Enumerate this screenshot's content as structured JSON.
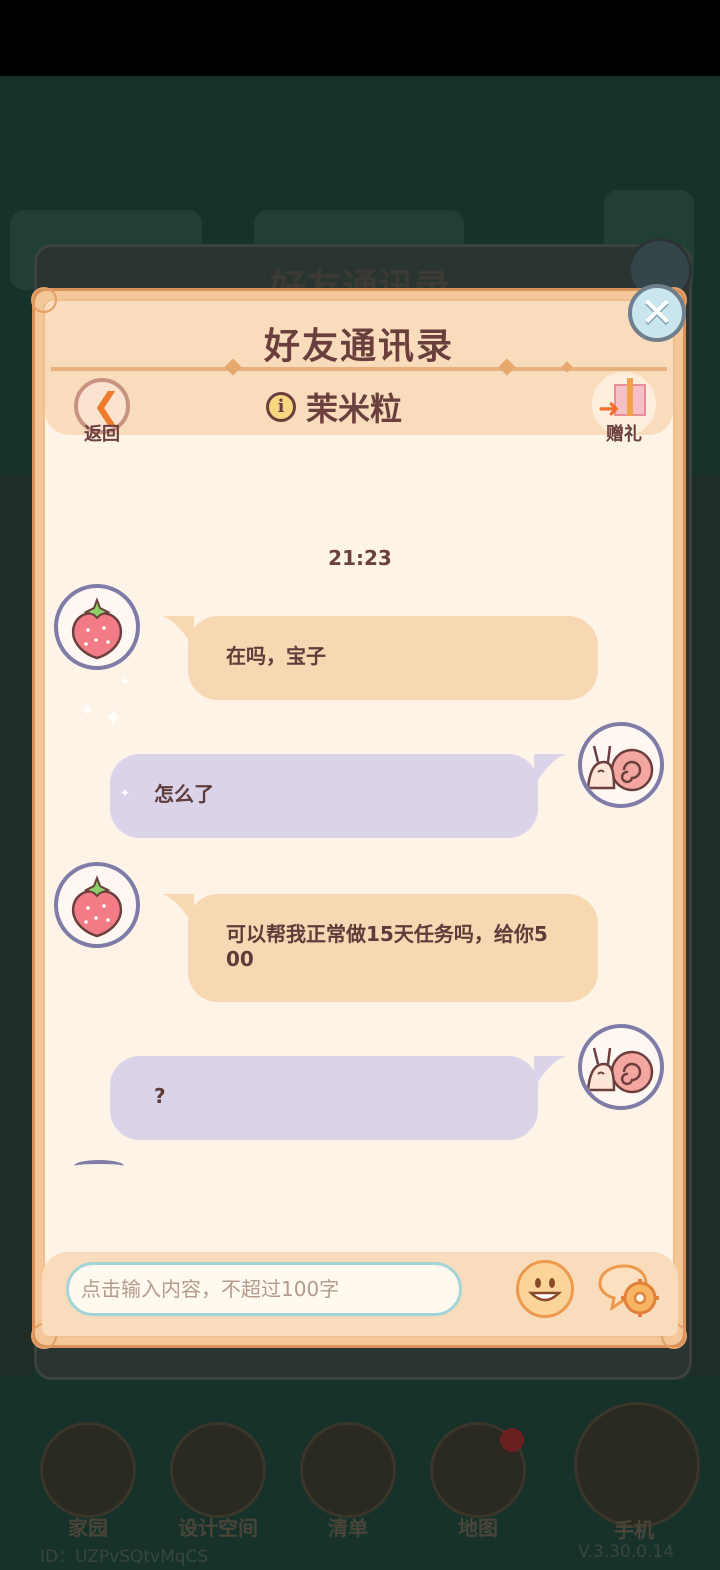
{
  "background": {
    "panel_title": "好友通讯录",
    "nav": [
      {
        "label": "家园"
      },
      {
        "label": "设计空间"
      },
      {
        "label": "清单"
      },
      {
        "label": "地图"
      }
    ],
    "phone_label": "手机",
    "id_text": "ID：UZPvSQtvMqCS",
    "version": "V.3.30.0.14"
  },
  "dialog": {
    "title": "好友通讯录",
    "back_label": "返回",
    "gift_label": "赠礼",
    "contact_name": "茉米粒",
    "info_icon": "i",
    "close_icon": "✕"
  },
  "chat": {
    "timestamp": "21:23",
    "messages": [
      {
        "side": "left",
        "avatar": "strawberry",
        "text": "在吗，宝子"
      },
      {
        "side": "right",
        "avatar": "snail",
        "text": "怎么了"
      },
      {
        "side": "left",
        "avatar": "strawberry",
        "text": "可以帮我正常做15天任务吗，给你500"
      },
      {
        "side": "right",
        "avatar": "snail",
        "text": "?"
      }
    ]
  },
  "input": {
    "placeholder": "点击输入内容，不超过100字",
    "value": ""
  },
  "colors": {
    "dialog_border": "#d9915a",
    "dialog_bg": "#fdf3e6",
    "header_band": "#f9dcbc",
    "title_text": "#6b3f3d",
    "left_bubble": "#f8d7b3",
    "right_bubble": "#dad3ea",
    "avatar_ring": "#7f7ca8"
  },
  "icons": [
    "close-icon",
    "back-arrow-icon",
    "info-icon",
    "gift-icon",
    "strawberry-avatar-icon",
    "snail-avatar-icon",
    "emoji-icon",
    "chat-settings-icon"
  ]
}
